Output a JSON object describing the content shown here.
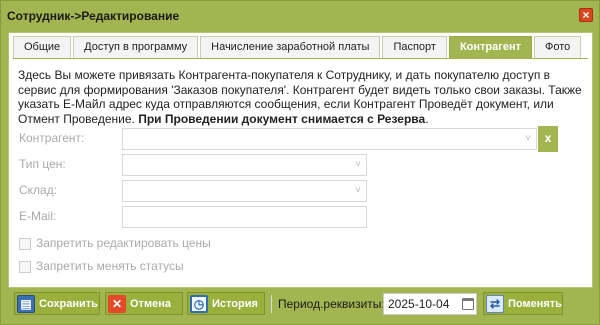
{
  "window": {
    "title": "Сотрудник->Редактирование",
    "close_icon": "close-icon"
  },
  "tabs": [
    {
      "label": "Общие",
      "active": false
    },
    {
      "label": "Доступ в программу",
      "active": false
    },
    {
      "label": "Начисление заработной платы",
      "active": false
    },
    {
      "label": "Паспорт",
      "active": false
    },
    {
      "label": "Контрагент",
      "active": true
    },
    {
      "label": "Фото",
      "active": false
    }
  ],
  "info": {
    "text_line1": "Здесь Вы можете привязать Контрагента-покупателя к Сотруднику, и дать покупателю доступ в сервис для формирования 'Заказов покупателя'. Контрагент будет видеть только свои заказы. Также указать Е-Майл адрес куда отправляются сообщения, если Контрагент Проведёт документ, или Отмент Проведение.",
    "text_bold": "При Проведении документ снимается с Резерва",
    "text_end": "."
  },
  "form": {
    "counterparty_label": "Контрагент:",
    "counterparty_value": "",
    "clear_label": "x",
    "price_type_label": "Тип цен:",
    "price_type_value": "",
    "warehouse_label": "Склад:",
    "warehouse_value": "",
    "email_label": "E-Mail:",
    "email_value": "",
    "checkbox_prices_label": "Запретить редактировать цены",
    "checkbox_prices_checked": false,
    "checkbox_status_label": "Запретить менять статусы",
    "checkbox_status_checked": false
  },
  "footer": {
    "save_label": "Сохранить",
    "cancel_label": "Отмена",
    "history_label": "История",
    "period_label": "Период.реквизиты:",
    "period_date": "2025-10-04",
    "apply_label": "Поменять"
  },
  "colors": {
    "accent": "#a3b551",
    "close": "#d9471f",
    "disabled_text": "#aaaaaa"
  }
}
